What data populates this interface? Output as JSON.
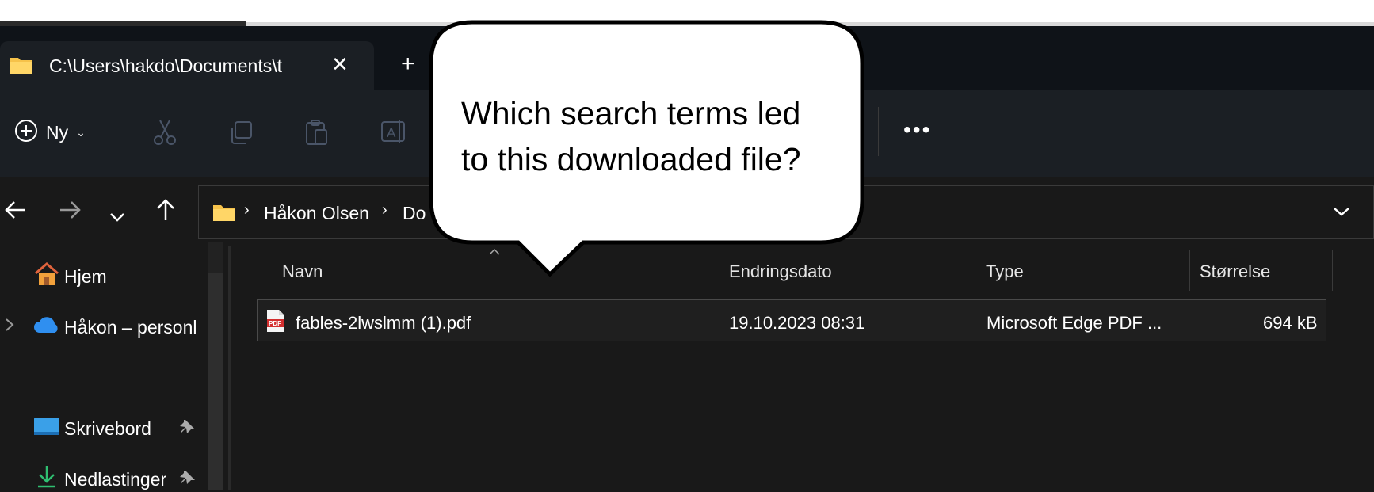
{
  "window": {
    "tab_title": "C:\\Users\\hakdo\\Documents\\t",
    "new_tab_symbol": "+",
    "close_symbol": "✕"
  },
  "toolbar": {
    "new_label": "Ny",
    "more_label": "•••",
    "icons": [
      "cut-icon",
      "copy-icon",
      "paste-icon",
      "rename-icon"
    ]
  },
  "navigation": {
    "back": "back-arrow-icon",
    "forward": "forward-arrow-icon",
    "recent": "chevron-down-icon",
    "up": "up-arrow-icon"
  },
  "address_bar": {
    "crumbs": [
      "Håkon Olsen",
      "Do"
    ],
    "separator": "›"
  },
  "sidebar": {
    "items": [
      {
        "label": "Hjem",
        "icon": "home-icon"
      },
      {
        "label": "Håkon – personl",
        "icon": "onedrive-cloud-icon"
      },
      {
        "label": "Skrivebord",
        "icon": "desktop-icon",
        "pinned": true
      },
      {
        "label": "Nedlastinger",
        "icon": "download-icon",
        "pinned": true
      }
    ]
  },
  "file_list": {
    "columns": [
      "Navn",
      "Endringsdato",
      "Type",
      "Størrelse"
    ],
    "rows": [
      {
        "name": "fables-2lwslmm (1).pdf",
        "date": "19.10.2023 08:31",
        "type": "Microsoft Edge PDF ...",
        "size": "694 kB"
      }
    ]
  },
  "callout": {
    "line1": "Which search terms led",
    "line2": "to this downloaded file?"
  },
  "colors": {
    "folder_yellow": "#f6c24a",
    "accent_blue": "#4cc2ff",
    "pdf_red": "#d32f2f"
  }
}
